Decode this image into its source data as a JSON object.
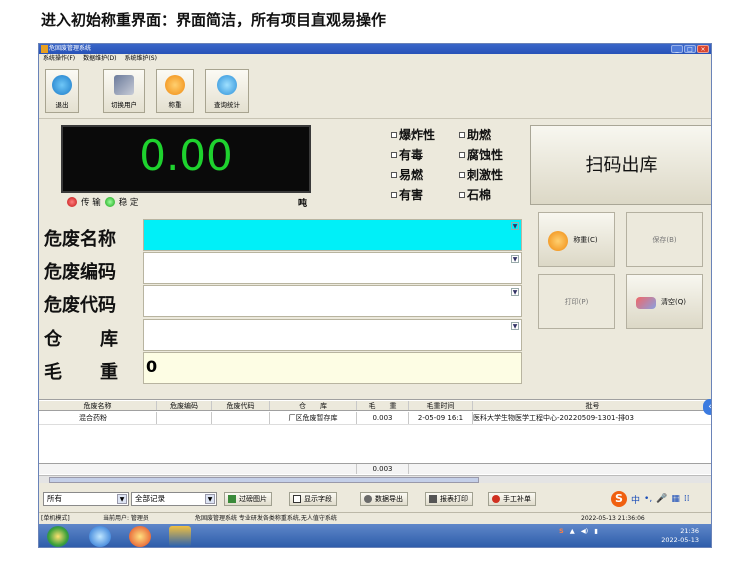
{
  "heading": "进入初始称重界面：界面简洁，所有项目直观易操作",
  "window": {
    "title": "危固废管理系统",
    "controls": [
      "_",
      "□",
      "×"
    ]
  },
  "menu": [
    "系统操作(F)",
    "数据维护(D)",
    "系统维护(S)"
  ],
  "toolbar": {
    "exit": "退出",
    "switch_user": "切换用户",
    "weigh": "称重",
    "query": "查询统计"
  },
  "scale": {
    "value": "0.00",
    "transmit": "传 输",
    "stable": "稳 定",
    "unit": "吨"
  },
  "hazards": [
    "爆炸性",
    "助燃",
    "有毒",
    "腐蚀性",
    "易燃",
    "刺激性",
    "有害",
    "石棉"
  ],
  "scan_button": "扫码出库",
  "fields": {
    "name_label": "危废名称",
    "code_label": "危废编码",
    "code2_label": "危废代码",
    "warehouse_label": "仓　库",
    "gross_label": "毛　重",
    "gross_value": "0"
  },
  "actions": {
    "weigh": "称重(C)",
    "save": "保存(B)",
    "print": "打印(P)",
    "clear": "清空(Q)"
  },
  "grid": {
    "headers": [
      "危废名称",
      "危废编码",
      "危废代码",
      "仓　　库",
      "毛　　重",
      "毛重时间",
      "批号"
    ],
    "rows": [
      [
        "混合药粉",
        "",
        "",
        "厂区危废暂存库",
        "0.003",
        "2-05-09 16:1",
        "医科大学生物医学工程中心-20220509-1301-排03"
      ]
    ],
    "sum": "0.003"
  },
  "bottombar": {
    "filter1": "所有",
    "filter2": "全部记录",
    "filter_image": "过磅图片",
    "show_fields": "显示字段",
    "export": "数据导出",
    "report_print": "报表打印",
    "supplement": "手工补单"
  },
  "ime": {
    "logo": "S",
    "lang": "中"
  },
  "statusbar": {
    "weigh_mode": "[单机模式]",
    "current_user": "当前用户: 管理员",
    "system": "危固废管理系统 专业研发各类称重系统,无人值守系统",
    "datetime": "2022-05-13 21:36:06"
  },
  "taskbar": {
    "time": "21:36",
    "date": "2022-05-13"
  },
  "colors": {
    "accent": "#00f0f8",
    "display_digits": "#1ed22e",
    "led_red": "#d81818",
    "led_green": "#18c018"
  }
}
